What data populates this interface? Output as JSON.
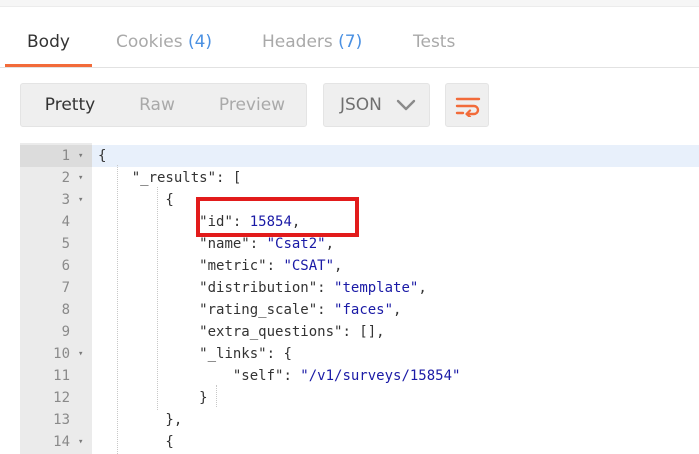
{
  "response_tabs": [
    {
      "label": "Body",
      "count": "",
      "active": true
    },
    {
      "label": "Cookies",
      "count": "(4)",
      "active": false
    },
    {
      "label": "Headers",
      "count": "(7)",
      "active": false
    },
    {
      "label": "Tests",
      "count": "",
      "active": false
    }
  ],
  "view_modes": [
    {
      "label": "Pretty",
      "active": true
    },
    {
      "label": "Raw",
      "active": false
    },
    {
      "label": "Preview",
      "active": false
    }
  ],
  "format_select": {
    "value": "JSON"
  },
  "wrap_button": {
    "icon": "wrap-lines-icon"
  },
  "colors": {
    "accent": "#f26b3a",
    "count": "#4a90e2",
    "highlight": "#e21b1b",
    "string": "#1a1aa6"
  },
  "editor": {
    "lines": [
      {
        "num": "1",
        "fold": true,
        "tokens": [
          {
            "t": "{",
            "c": "p"
          }
        ]
      },
      {
        "num": "2",
        "fold": true,
        "tokens": [
          {
            "t": "    ",
            "c": "p"
          },
          {
            "t": "\"_results\"",
            "c": "k"
          },
          {
            "t": ": [",
            "c": "p"
          }
        ]
      },
      {
        "num": "3",
        "fold": true,
        "tokens": [
          {
            "t": "        {",
            "c": "p"
          }
        ]
      },
      {
        "num": "4",
        "fold": false,
        "tokens": [
          {
            "t": "            ",
            "c": "p"
          },
          {
            "t": "\"id\"",
            "c": "k"
          },
          {
            "t": ": ",
            "c": "p"
          },
          {
            "t": "15854",
            "c": "n"
          },
          {
            "t": ",",
            "c": "p"
          }
        ]
      },
      {
        "num": "5",
        "fold": false,
        "tokens": [
          {
            "t": "            ",
            "c": "p"
          },
          {
            "t": "\"name\"",
            "c": "k"
          },
          {
            "t": ": ",
            "c": "p"
          },
          {
            "t": "\"Csat2\"",
            "c": "s"
          },
          {
            "t": ",",
            "c": "p"
          }
        ]
      },
      {
        "num": "6",
        "fold": false,
        "tokens": [
          {
            "t": "            ",
            "c": "p"
          },
          {
            "t": "\"metric\"",
            "c": "k"
          },
          {
            "t": ": ",
            "c": "p"
          },
          {
            "t": "\"CSAT\"",
            "c": "s"
          },
          {
            "t": ",",
            "c": "p"
          }
        ]
      },
      {
        "num": "7",
        "fold": false,
        "tokens": [
          {
            "t": "            ",
            "c": "p"
          },
          {
            "t": "\"distribution\"",
            "c": "k"
          },
          {
            "t": ": ",
            "c": "p"
          },
          {
            "t": "\"template\"",
            "c": "s"
          },
          {
            "t": ",",
            "c": "p"
          }
        ]
      },
      {
        "num": "8",
        "fold": false,
        "tokens": [
          {
            "t": "            ",
            "c": "p"
          },
          {
            "t": "\"rating_scale\"",
            "c": "k"
          },
          {
            "t": ": ",
            "c": "p"
          },
          {
            "t": "\"faces\"",
            "c": "s"
          },
          {
            "t": ",",
            "c": "p"
          }
        ]
      },
      {
        "num": "9",
        "fold": false,
        "tokens": [
          {
            "t": "            ",
            "c": "p"
          },
          {
            "t": "\"extra_questions\"",
            "c": "k"
          },
          {
            "t": ": [],",
            "c": "p"
          }
        ]
      },
      {
        "num": "10",
        "fold": true,
        "tokens": [
          {
            "t": "            ",
            "c": "p"
          },
          {
            "t": "\"_links\"",
            "c": "k"
          },
          {
            "t": ": {",
            "c": "p"
          }
        ]
      },
      {
        "num": "11",
        "fold": false,
        "tokens": [
          {
            "t": "                ",
            "c": "p"
          },
          {
            "t": "\"self\"",
            "c": "k"
          },
          {
            "t": ": ",
            "c": "p"
          },
          {
            "t": "\"/v1/surveys/15854\"",
            "c": "s"
          }
        ]
      },
      {
        "num": "12",
        "fold": false,
        "tokens": [
          {
            "t": "            }",
            "c": "p"
          }
        ]
      },
      {
        "num": "13",
        "fold": false,
        "tokens": [
          {
            "t": "        },",
            "c": "p"
          }
        ]
      },
      {
        "num": "14",
        "fold": true,
        "tokens": [
          {
            "t": "        {",
            "c": "p"
          }
        ]
      }
    ]
  }
}
